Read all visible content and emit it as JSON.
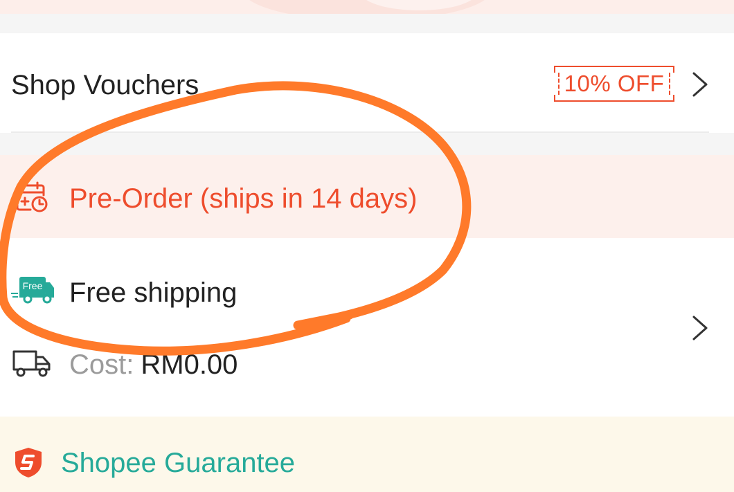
{
  "vouchers": {
    "label": "Shop Vouchers",
    "badge": "10% OFF"
  },
  "preorder": {
    "label": "Pre-Order (ships in 14 days)",
    "icon": "calendar-clock-icon"
  },
  "shipping": {
    "free_badge": "Free",
    "free_label": "Free shipping",
    "cost_label": "Cost:",
    "cost_value": "RM0.00"
  },
  "guarantee": {
    "label": "Shopee Guarantee",
    "icon": "shield-icon"
  },
  "colors": {
    "accent": "#ee4d2d",
    "guarantee": "#26aa99",
    "annotation": "#ff7a2a",
    "preorder_bg": "#fdf0ec",
    "guarantee_bg": "#fdf8ea"
  }
}
